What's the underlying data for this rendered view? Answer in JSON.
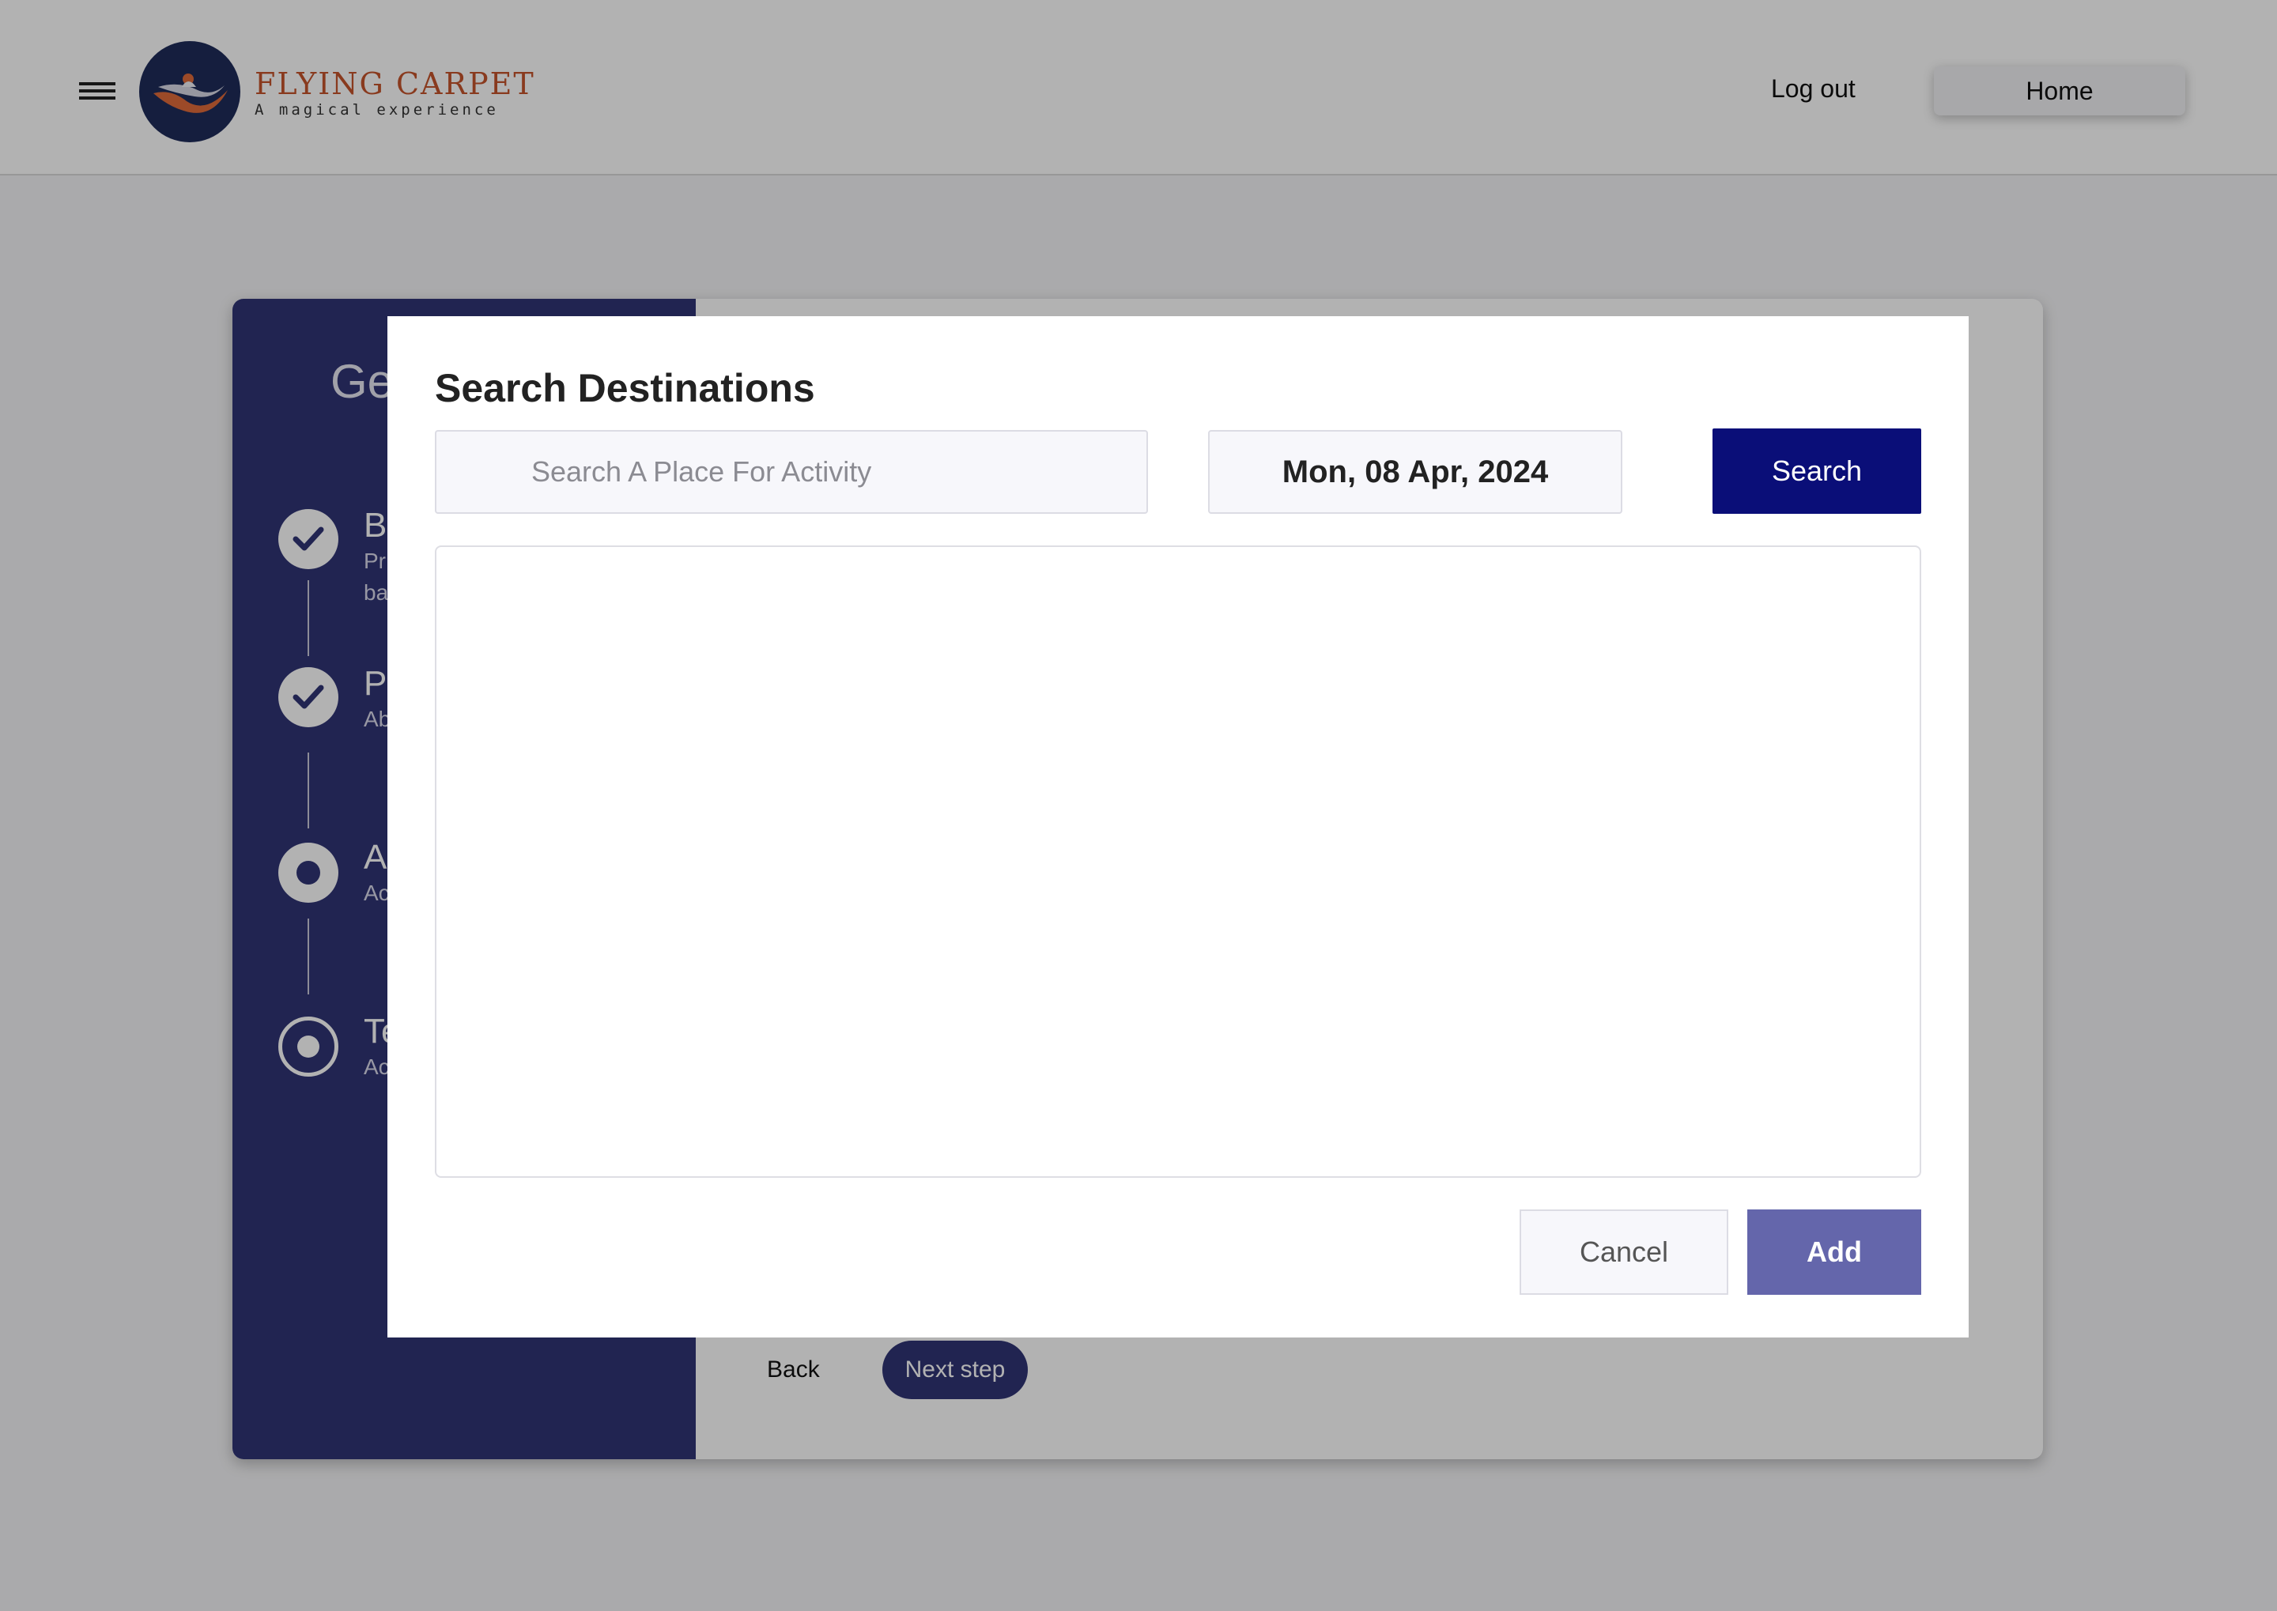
{
  "header": {
    "brand_title": "FLYING CARPET",
    "brand_tagline": "A magical experience",
    "logout_label": "Log out",
    "home_label": "Home"
  },
  "wizard": {
    "side_title": "Ge",
    "steps": [
      {
        "title": "B",
        "desc_line1": "Pr",
        "desc_line2": "ba",
        "state": "done"
      },
      {
        "title": "P",
        "desc_line1": "Ab",
        "state": "done"
      },
      {
        "title": "A",
        "desc_line1": "Ac",
        "state": "current"
      },
      {
        "title": "Te",
        "desc_line1": "Ac",
        "state": "upcoming"
      }
    ],
    "back_label": "Back",
    "next_label": "Next step"
  },
  "modal": {
    "title": "Search Destinations",
    "search_placeholder": "Search A Place For Activity",
    "search_value": "",
    "date_value": "Mon, 08 Apr, 2024",
    "search_button_label": "Search",
    "cancel_label": "Cancel",
    "add_label": "Add"
  },
  "colors": {
    "primary_navy": "#0a0e78",
    "sidebar_navy": "#303475",
    "add_button": "#6466ab",
    "brand_orange": "#c4542b",
    "overlay": "rgba(0,0,0,0.30)"
  },
  "icons": {
    "menu": "hamburger-icon",
    "done_step": "check-icon",
    "current_step": "dot-icon",
    "upcoming_step": "ring-dot-icon"
  }
}
